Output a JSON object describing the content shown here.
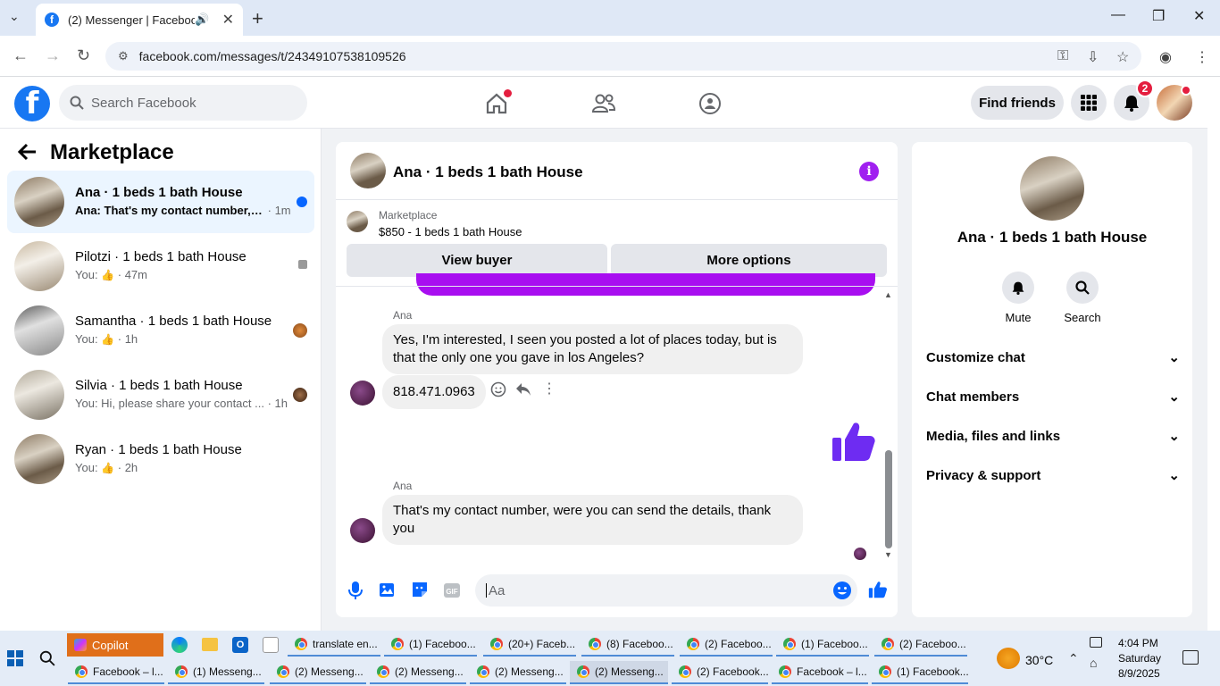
{
  "browser": {
    "tab_title": "(2) Messenger | Facebook",
    "url": "facebook.com/messages/t/24349107538109526"
  },
  "fb": {
    "search_placeholder": "Search Facebook",
    "find_friends": "Find friends",
    "notif_count": "2"
  },
  "sidebar": {
    "title": "Marketplace",
    "conversations": [
      {
        "name": "Ana · 1 beds 1 bath House",
        "preview": "Ana: That's my contact number, w...",
        "time": "· 1m",
        "active": true
      },
      {
        "name": "Pilotzi · 1 beds 1 bath House",
        "preview": "You:",
        "time": "· 47m"
      },
      {
        "name": "Samantha · 1 beds 1 bath House",
        "preview": "You:",
        "time": "· 1h"
      },
      {
        "name": "Silvia · 1 beds 1 bath House",
        "preview": "You: Hi, please share your contact ...",
        "time": "· 1h"
      },
      {
        "name": "Ryan · 1 beds 1 bath House",
        "preview": "You:",
        "time": "· 2h"
      }
    ]
  },
  "chat": {
    "title": "Ana · 1 beds 1 bath House",
    "marketplace_label": "Marketplace",
    "listing": "$850 - 1 beds 1 bath House",
    "view_buyer": "View buyer",
    "more_options": "More options",
    "messages": [
      {
        "sender": "Ana",
        "text": "Yes, I'm interested, I seen you posted a lot of places today, but is that the only one you gave in los Angeles?"
      },
      {
        "text": "818.471.0963"
      },
      {
        "sender": "Ana",
        "text": "That's my contact number, were you can send the details, thank you"
      }
    ],
    "composer_placeholder": "Aa"
  },
  "right_panel": {
    "name": "Ana · 1 beds 1 bath House",
    "mute": "Mute",
    "search": "Search",
    "sections": [
      "Customize chat",
      "Chat members",
      "Media, files and links",
      "Privacy & support"
    ]
  },
  "taskbar": {
    "copilot": "Copilot",
    "row1": [
      "translate en...",
      "(1) Faceboo...",
      "(20+) Faceb...",
      "(8) Faceboo...",
      "(2) Faceboo...",
      "(1) Faceboo...",
      "(2) Faceboo..."
    ],
    "row2": [
      "Facebook – l...",
      "(1) Messeng...",
      "(2) Messeng...",
      "(2) Messeng...",
      "(2) Messeng...",
      "(2) Messeng...",
      "(2) Facebook...",
      "Facebook – l...",
      "(1) Facebook..."
    ],
    "temperature": "30°C",
    "time": "4:04 PM",
    "day": "Saturday",
    "date": "8/9/2025"
  },
  "colors": {
    "fb_blue": "#1877f2",
    "purple": "#a80ef0",
    "like_blue": "#0a7cff"
  }
}
